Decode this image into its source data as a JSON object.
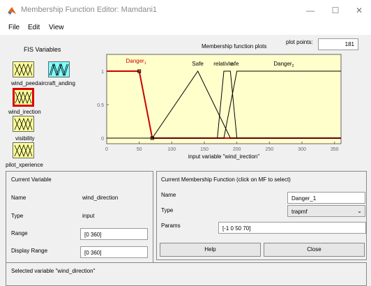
{
  "window": {
    "title": "Membership Function Editor: Mamdani1",
    "minimize": "—",
    "maximize": "☐",
    "close": "✕"
  },
  "menu": [
    "File",
    "Edit",
    "View"
  ],
  "fis": {
    "label": "FIS Variables",
    "variables": [
      {
        "name": "wind_peed",
        "kind": "input"
      },
      {
        "name": "aircraft_anding",
        "kind": "output"
      },
      {
        "name": "wind_irection",
        "kind": "input"
      },
      {
        "name": "visibility",
        "kind": "input"
      },
      {
        "name": "pilot_xperience",
        "kind": "input"
      }
    ]
  },
  "plot": {
    "title": "Membership function plots",
    "points_label": "plot points:",
    "points_value": "181",
    "mf_labels": [
      "Danger",
      "Safe",
      "relativle",
      "afe",
      "Danger"
    ],
    "mf_label_subscripts": [
      "1",
      "",
      "",
      "",
      "2"
    ],
    "colors": {
      "selected": "#cc0000",
      "normal": "#000000",
      "bg": "#ffffcc"
    }
  },
  "chart_data": {
    "type": "line",
    "xlabel": "input variable \"wind_irection\"",
    "xlim": [
      0,
      360
    ],
    "ylim": [
      0,
      1
    ],
    "xticks": [
      0,
      50,
      100,
      150,
      200,
      250,
      300,
      350
    ],
    "yticks": [
      0,
      0.5,
      1
    ],
    "series": [
      {
        "name": "Danger_1",
        "selected": true,
        "x": [
          -1,
          0,
          50,
          70,
          360
        ],
        "y": [
          1,
          1,
          1,
          0,
          0
        ]
      },
      {
        "name": "Safe",
        "selected": false,
        "x": [
          0,
          70,
          140,
          190,
          360
        ],
        "y": [
          0,
          0,
          1,
          0,
          0
        ]
      },
      {
        "name": "relativle_afe",
        "selected": false,
        "x": [
          0,
          170,
          180,
          190,
          200,
          360
        ],
        "y": [
          0,
          0,
          1,
          1,
          0,
          0
        ]
      },
      {
        "name": "Danger_2",
        "selected": false,
        "x": [
          0,
          180,
          200,
          360
        ],
        "y": [
          0,
          0,
          1,
          1
        ]
      }
    ]
  },
  "current_variable": {
    "title": "Current Variable",
    "name_label": "Name",
    "name_value": "wind_direction",
    "type_label": "Type",
    "type_value": "input",
    "range_label": "Range",
    "range_value": "[0 360]",
    "display_range_label": "Display Range",
    "display_range_value": "[0 360]"
  },
  "current_mf": {
    "title": "Current Membership Function (click on MF to select)",
    "name_label": "Name",
    "name_value": "Danger_1",
    "type_label": "Type",
    "type_value": "trapmf",
    "params_label": "Params",
    "params_value": "[-1 0 50 70]"
  },
  "buttons": {
    "help": "Help",
    "close": "Close"
  },
  "status": "Selected variable \"wind_direction\""
}
